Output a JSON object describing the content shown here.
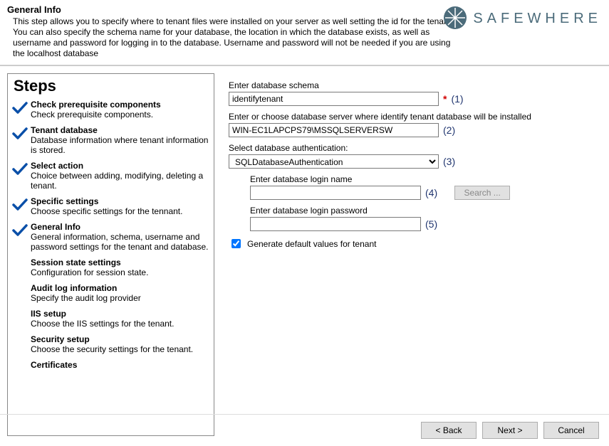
{
  "header": {
    "title": "General Info",
    "description": "This step allows you to specify where to tenant files were installed on your server as well setting the id for the tenant. You can also specify the schema name for your database, the location in which the database exists, as well as username and password for logging in to the database. Username and password will not be needed if you are using the localhost database"
  },
  "brand": {
    "name": "SAFEWHERE"
  },
  "steps": {
    "title": "Steps",
    "items": [
      {
        "title": "Check prerequisite components",
        "desc": "Check prerequisite components.",
        "checked": true
      },
      {
        "title": "Tenant database",
        "desc": "Database information where tenant information is stored.",
        "checked": true
      },
      {
        "title": "Select action",
        "desc": "Choice between adding, modifying, deleting a tenant.",
        "checked": true
      },
      {
        "title": "Specific settings",
        "desc": "Choose specific settings for the tennant.",
        "checked": true
      },
      {
        "title": "General Info",
        "desc": "General information, schema, username and password settings for the tenant and database.",
        "checked": true
      },
      {
        "title": "Session state settings",
        "desc": "Configuration for session state.",
        "checked": false
      },
      {
        "title": "Audit log information",
        "desc": "Specify the audit log provider",
        "checked": false
      },
      {
        "title": "IIS setup",
        "desc": "Choose the IIS settings for the tenant.",
        "checked": false
      },
      {
        "title": "Security setup",
        "desc": "Choose the security settings for the tenant.",
        "checked": false
      },
      {
        "title": "Certificates",
        "desc": "",
        "checked": false
      }
    ]
  },
  "form": {
    "schema_label": "Enter database schema",
    "schema_value": "identifytenant",
    "schema_hint": "(1)",
    "server_label": "Enter or choose database server where identify tenant database will be installed",
    "server_value": "WIN-EC1LAPCPS79\\MSSQLSERVERSW",
    "server_hint": "(2)",
    "auth_label": "Select database authentication:",
    "auth_value": "SQLDatabaseAuthentication",
    "auth_hint": "(3)",
    "login_label": "Enter database login name",
    "login_value": "",
    "login_hint": "(4)",
    "search_label": "Search ...",
    "password_label": "Enter database login password",
    "password_value": "",
    "password_hint": "(5)",
    "generate_label": "Generate default values for tenant",
    "generate_checked": true
  },
  "footer": {
    "back": "< Back",
    "next": "Next >",
    "cancel": "Cancel"
  }
}
